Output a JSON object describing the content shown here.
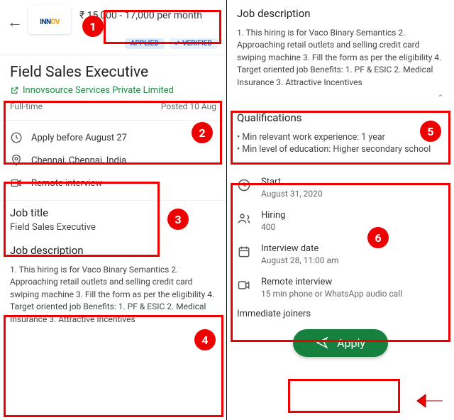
{
  "header": {
    "logo_main": "INN",
    "logo_accent": "OV",
    "salary": "₹ 15,000 - 17,000 per month",
    "badge_applied": "APPLIED",
    "badge_verified": "VERIFIED"
  },
  "job": {
    "title": "Field Sales Executive",
    "company": "Innovsource Services Private Limited",
    "type": "Full-time",
    "posted": "Posted 10 Aug"
  },
  "info": {
    "deadline": "Apply before August 27",
    "location": "Chennai, Chennai, India",
    "interview_mode": "Remote interview"
  },
  "sections": {
    "job_title_h": "Job title",
    "job_title_v": "Field Sales Executive",
    "job_desc_h": "Job description",
    "job_desc": "1. This hiring is for Vaco Binary Semantics 2. Approaching retail outlets and selling credit card swiping machine 3. Fill the form as per the eligibility 4. Target oriented job Benefits: 1. PF & ESIC 2. Medical Insurance 3. Attractive Incentives",
    "qual_h": "Qualifications",
    "qual1": "• Min relevant work experience: 1 year",
    "qual2": "• Min level of education: Higher secondary school"
  },
  "details": {
    "start_l": "Start",
    "start_v": "August 31, 2020",
    "hiring_l": "Hiring",
    "hiring_v": "400",
    "interview_l": "Interview date",
    "interview_v": "August 28, 11:00 am",
    "remote_l": "Remote interview",
    "remote_v": "15 min phone or WhatsApp audio call"
  },
  "footer": {
    "immediate": "Immediate joiners",
    "apply": "Apply"
  },
  "annotations": {
    "n1": "1",
    "n2": "2",
    "n3": "3",
    "n4": "4",
    "n5": "5",
    "n6": "6"
  }
}
